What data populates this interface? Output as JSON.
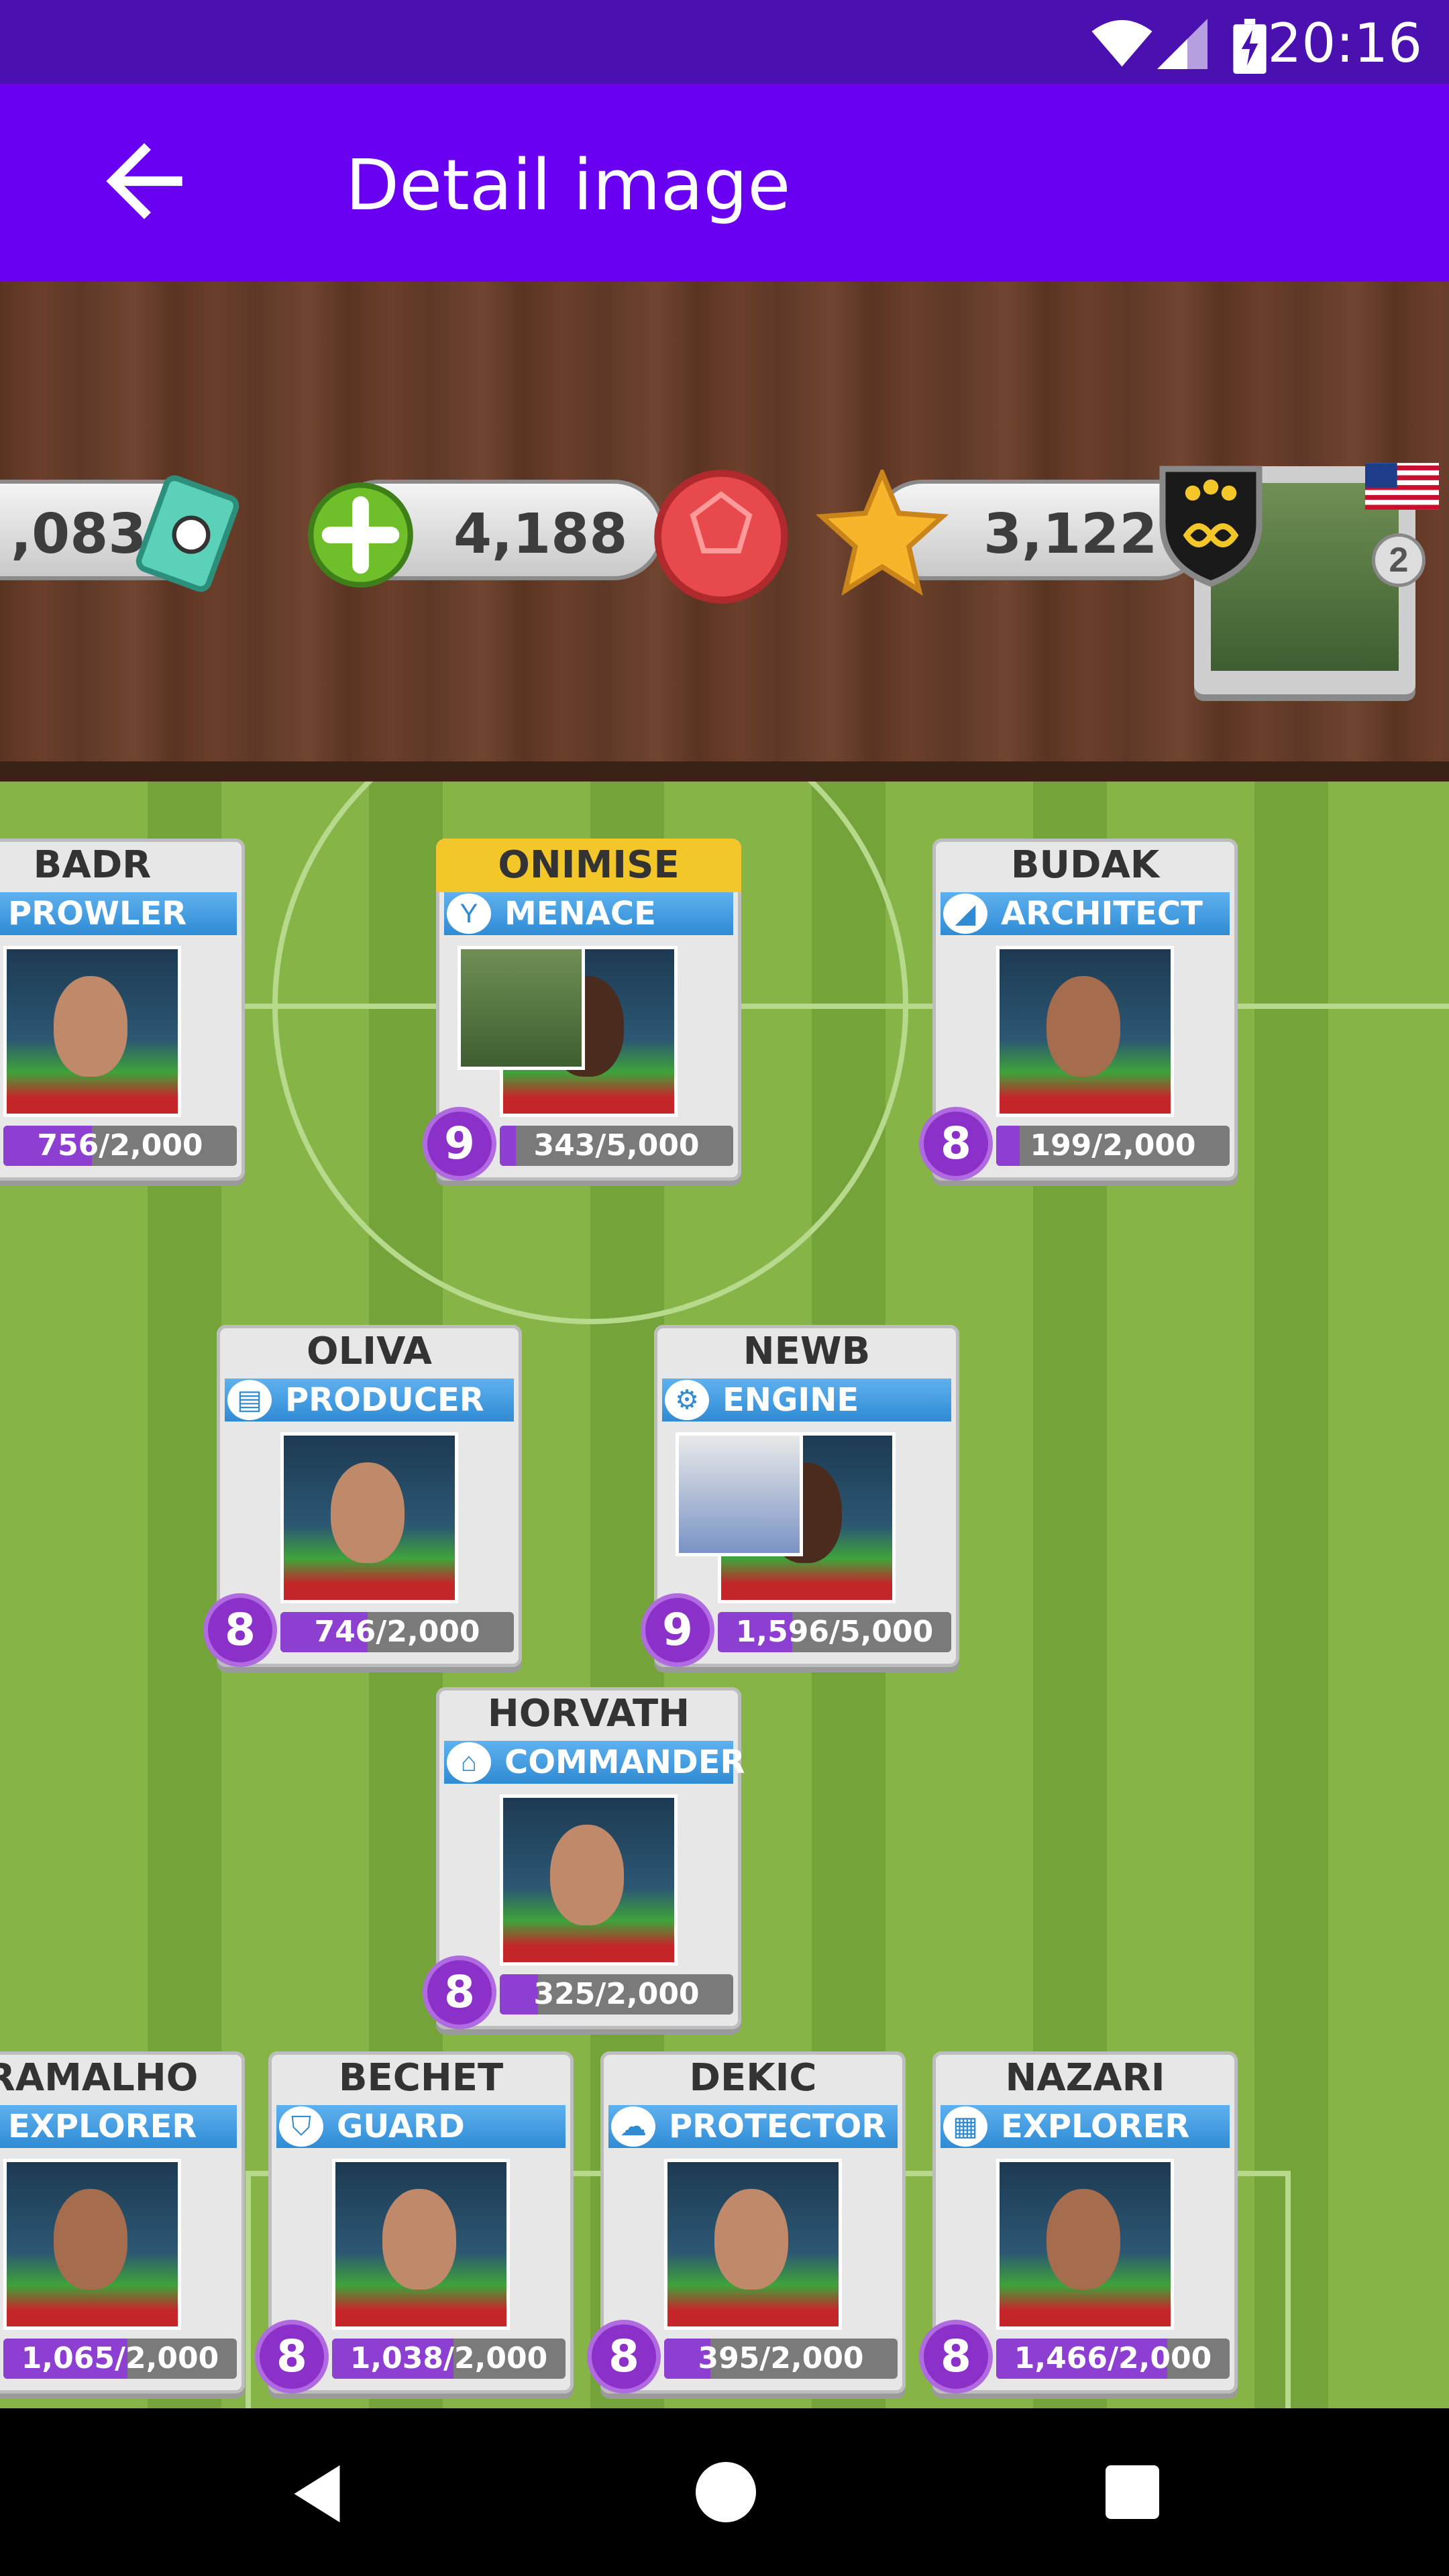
{
  "status_bar": {
    "time": "20:16"
  },
  "app_bar": {
    "title": "Detail image"
  },
  "resources": {
    "cash": ",083",
    "balls": "4,188",
    "stars": "3,122",
    "profile_rank": "2"
  },
  "cards": [
    {
      "name": "BADR",
      "role": "PROWLER",
      "progress_text": "756/2,000",
      "progress": 0.378,
      "level": ""
    },
    {
      "name": "ONIMISE",
      "role": "MENACE",
      "progress_text": "343/5,000",
      "progress": 0.069,
      "level": "9"
    },
    {
      "name": "BUDAK",
      "role": "ARCHITECT",
      "progress_text": "199/2,000",
      "progress": 0.1,
      "level": "8"
    },
    {
      "name": "OLIVA",
      "role": "PRODUCER",
      "progress_text": "746/2,000",
      "progress": 0.373,
      "level": "8"
    },
    {
      "name": "NEWB",
      "role": "ENGINE",
      "progress_text": "1,596/5,000",
      "progress": 0.319,
      "level": "9"
    },
    {
      "name": "HORVATH",
      "role": "COMMANDER",
      "progress_text": "325/2,000",
      "progress": 0.163,
      "level": "8"
    },
    {
      "name": "RAMALHO",
      "role": "EXPLORER",
      "progress_text": "1,065/2,000",
      "progress": 0.533,
      "level": ""
    },
    {
      "name": "BECHET",
      "role": "GUARD",
      "progress_text": "1,038/2,000",
      "progress": 0.519,
      "level": "8"
    },
    {
      "name": "DEKIC",
      "role": "PROTECTOR",
      "progress_text": "395/2,000",
      "progress": 0.198,
      "level": "8"
    },
    {
      "name": "NAZARI",
      "role": "EXPLORER",
      "progress_text": "1,466/2,000",
      "progress": 0.733,
      "level": "8"
    }
  ]
}
